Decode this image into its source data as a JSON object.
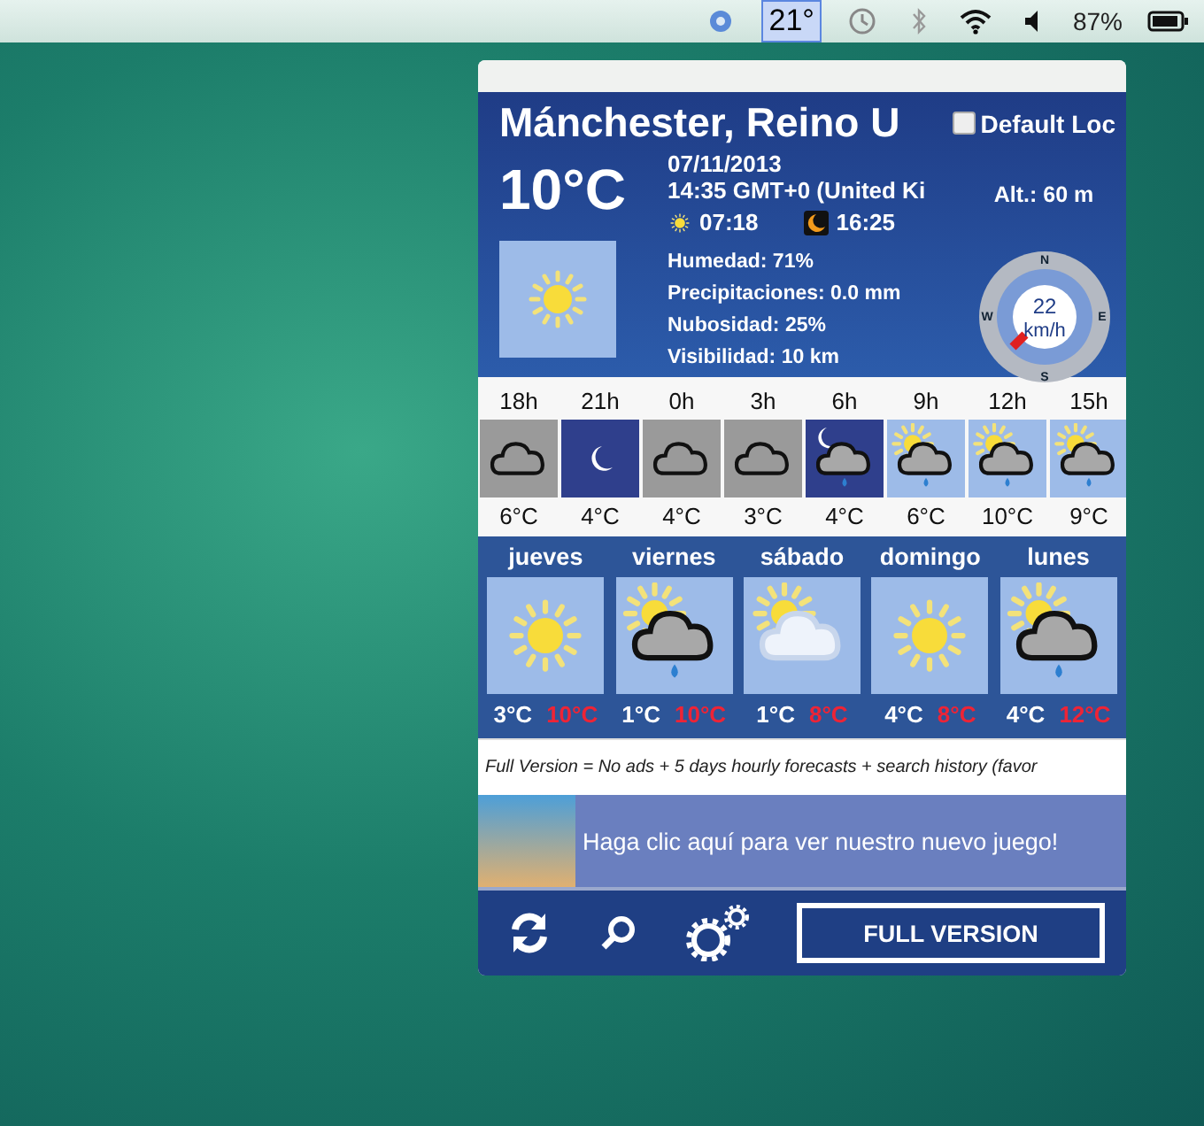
{
  "menu_bar": {
    "temperature": "21°",
    "battery": "87%"
  },
  "header": {
    "city": "Mánchester, Reino U",
    "default_location": {
      "label": "Default Loc",
      "checked": false
    },
    "temperature": "10°C",
    "date": "07/11/2013",
    "time": "14:35 GMT+0 (United Ki",
    "sunrise": "07:18",
    "sunset": "16:25",
    "altitude": "Alt.: 60 m",
    "details": [
      "Humedad: 71%",
      "Precipitaciones: 0.0 mm",
      "Nubosidad: 25%",
      "Visibilidad: 10 km"
    ],
    "wind": {
      "speed": "22",
      "unit": "km/h",
      "north": "N",
      "east": "E",
      "south": "S",
      "west": "W"
    }
  },
  "hourly": [
    {
      "hour": "18h",
      "kind": "cloud",
      "temp": "6°C"
    },
    {
      "hour": "21h",
      "kind": "moon",
      "temp": "4°C"
    },
    {
      "hour": "0h",
      "kind": "cloud",
      "temp": "4°C"
    },
    {
      "hour": "3h",
      "kind": "cloud",
      "temp": "3°C"
    },
    {
      "hour": "6h",
      "kind": "moon-cloud-rain",
      "temp": "4°C"
    },
    {
      "hour": "9h",
      "kind": "sun-cloud-rain",
      "temp": "6°C"
    },
    {
      "hour": "12h",
      "kind": "sun-cloud-rain",
      "temp": "10°C"
    },
    {
      "hour": "15h",
      "kind": "sun-cloud-rain",
      "temp": "9°C"
    }
  ],
  "daily": [
    {
      "day": "jueves",
      "kind": "sun",
      "low": "3°C",
      "high": "10°C"
    },
    {
      "day": "viernes",
      "kind": "sun-cloud-rain",
      "low": "1°C",
      "high": "10°C"
    },
    {
      "day": "sábado",
      "kind": "sun-cloud",
      "low": "1°C",
      "high": "8°C"
    },
    {
      "day": "domingo",
      "kind": "sun",
      "low": "4°C",
      "high": "8°C"
    },
    {
      "day": "lunes",
      "kind": "sun-cloud-rain",
      "low": "4°C",
      "high": "12°C"
    }
  ],
  "promo_text": "Full Version = No ads + 5 days hourly forecasts + search history (favor",
  "ad_text": "Haga clic aquí para ver nuestro nuevo juego!",
  "toolbar": {
    "full_version_button": "FULL VERSION"
  }
}
